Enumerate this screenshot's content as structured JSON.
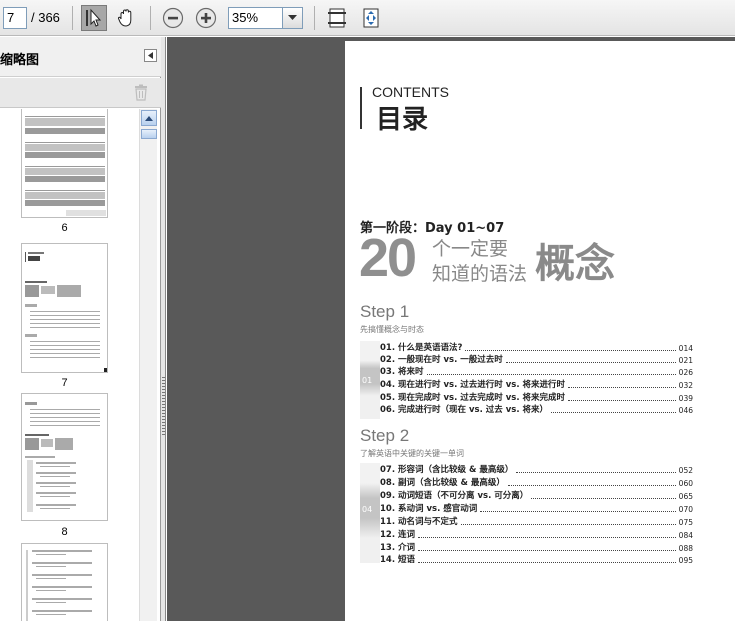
{
  "toolbar": {
    "page_current": "7",
    "page_total": "/ 366",
    "zoom": "35%"
  },
  "sidebar": {
    "title": "缩略图",
    "thumbnails": [
      {
        "label": "6"
      },
      {
        "label": "7"
      },
      {
        "label": "8"
      }
    ]
  },
  "document": {
    "contents_en": "CONTENTS",
    "contents_zh": "目录",
    "stage": "第一阶段：Day 01~07",
    "big_number": "20",
    "big_line1": "个一定要",
    "big_line2": "知道的语法",
    "big_line3": "概念",
    "steps": [
      {
        "title": "Step 1",
        "subtitle": "先搞懂概念与时态",
        "block_label": "01",
        "items": [
          {
            "text": "01. 什么是英语语法?",
            "page": "014"
          },
          {
            "text": "02. 一般现在时 vs. 一般过去时",
            "page": "021"
          },
          {
            "text": "03. 将来时",
            "page": "026"
          },
          {
            "text": "04. 现在进行时 vs. 过去进行时 vs. 将来进行时",
            "page": "032"
          },
          {
            "text": "05. 现在完成时 vs. 过去完成时 vs. 将来完成时",
            "page": "039"
          },
          {
            "text": "06. 完成进行时（现在 vs. 过去 vs. 将来）",
            "page": "046"
          }
        ]
      },
      {
        "title": "Step 2",
        "subtitle": "了解英语中关键的关键一单词",
        "block_label": "04",
        "items": [
          {
            "text": "07. 形容词（含比较级 & 最高级）",
            "page": "052"
          },
          {
            "text": "08. 副词（含比较级 & 最高级）",
            "page": "060"
          },
          {
            "text": "09. 动词短语（不可分离 vs. 可分离）",
            "page": "065"
          },
          {
            "text": "10. 系动词 vs. 感官动词",
            "page": "070"
          },
          {
            "text": "11. 动名词与不定式",
            "page": "075"
          },
          {
            "text": "12. 连词",
            "page": "084"
          },
          {
            "text": "13. 介词",
            "page": "088"
          },
          {
            "text": "14. 短语",
            "page": "095"
          }
        ]
      }
    ]
  }
}
